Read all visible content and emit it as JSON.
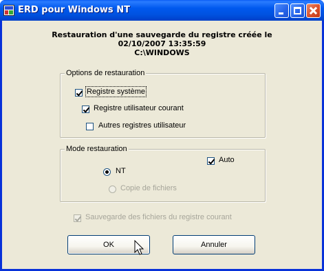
{
  "window": {
    "title": "ERD pour Windows NT",
    "icons": {
      "app": "erd-app-icon",
      "minimize": "minimize-icon",
      "maximize": "maximize-icon",
      "close": "close-icon"
    }
  },
  "header": {
    "line1": "Restauration d'une sauvegarde du registre créée le",
    "line2": "02/10/2007 13:35:59",
    "line3": "C:\\WINDOWS"
  },
  "options_group": {
    "legend": "Options de restauration",
    "registre_systeme": {
      "label": "Registre système",
      "checked": true
    },
    "registre_utilisateur": {
      "label": "Registre utilisateur courant",
      "checked": true
    },
    "autres_registres": {
      "label": "Autres registres utilisateur",
      "checked": false
    }
  },
  "mode_group": {
    "legend": "Mode restauration",
    "auto": {
      "label": "Auto",
      "checked": true
    },
    "nt": {
      "label": "NT",
      "selected": true
    },
    "copie": {
      "label": "Copie de fichiers",
      "selected": false,
      "enabled": false
    }
  },
  "sauvegarde": {
    "label": "Sauvegarde des fichiers du registre courant",
    "checked": true,
    "enabled": false
  },
  "buttons": {
    "ok": "OK",
    "cancel": "Annuler"
  },
  "colors": {
    "titlebar": "#0058ee",
    "client_bg": "#ece9d8",
    "disabled_text": "#a6a59a"
  }
}
